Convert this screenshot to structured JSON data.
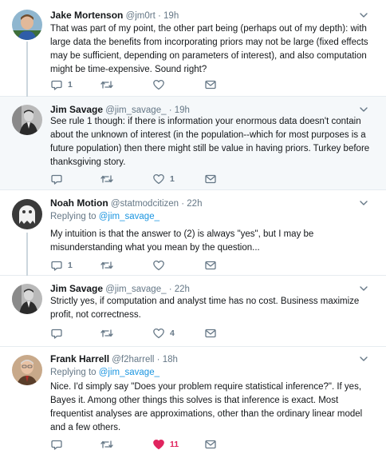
{
  "tweets": [
    {
      "name": "Jake Mortenson",
      "handle": "@jm0rt",
      "time": "19h",
      "text": "That was part of my point, the other part being (perhaps out of my depth): with large data the benefits from incorporating priors may not be large (fixed effects may be sufficient, depending on parameters of interest), and also computation might be time-expensive. Sound right?",
      "replies": "1",
      "retweets": "",
      "likes": ""
    },
    {
      "name": "Jim Savage",
      "handle": "@jim_savage_",
      "time": "19h",
      "text": "See rule 1 though: if there is information your enormous data doesn't contain about the unknown of interest (in the population--which for most purposes is a future population) then there might still be value in having priors. Turkey before thanksgiving story.",
      "replies": "",
      "retweets": "",
      "likes": "1"
    },
    {
      "name": "Noah Motion",
      "handle": "@statmodcitizen",
      "time": "22h",
      "replying_prefix": "Replying to",
      "replying_handle": "@jim_savage_",
      "text": "My intuition is that the answer to (2) is always \"yes\", but I may be misunderstanding what you mean by the question...",
      "replies": "1",
      "retweets": "",
      "likes": ""
    },
    {
      "name": "Jim Savage",
      "handle": "@jim_savage_",
      "time": "22h",
      "text": "Strictly yes, if computation and analyst time has no cost. Business maximize profit, not correctness.",
      "replies": "",
      "retweets": "",
      "likes": "4"
    },
    {
      "name": "Frank Harrell",
      "handle": "@f2harrell",
      "time": "18h",
      "replying_prefix": "Replying to",
      "replying_handle": "@jim_savage_",
      "text": "Nice.  I'd simply say \"Does your problem require statistical inference?\".  If yes, Bayes it.  Among other things this solves is that inference is exact.  Most frequentist analyses are approximations, other than the ordinary linear model and a few others.",
      "replies": "",
      "retweets": "",
      "likes": "11"
    }
  ],
  "sep": " · ",
  "colors": {
    "text": "#14171a",
    "meta": "#657786",
    "link": "#1b95e0",
    "like_active": "#e0245e",
    "highlight_bg": "#f5f8fa",
    "divider": "#e6ecf0"
  },
  "icons": [
    "reply-icon",
    "retweet-icon",
    "like-icon",
    "message-icon",
    "chevron-down-icon"
  ]
}
